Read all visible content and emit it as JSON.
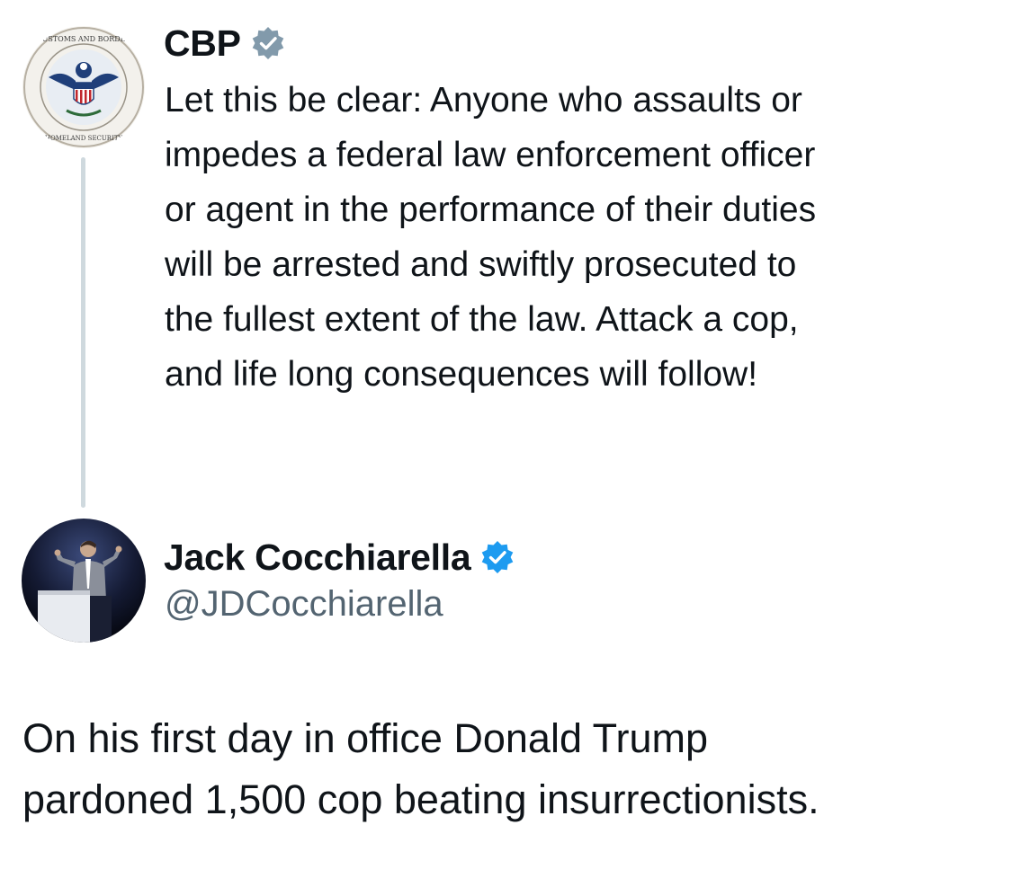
{
  "quoted_post": {
    "author_name": "CBP",
    "seal_text": {
      "outer_top": "U.S. CUSTOMS AND BORDER PROTECTION",
      "outer_bottom": "DEPARTMENT OF HOMELAND SECURITY"
    },
    "verified_badge": "gray-check-badge-icon",
    "text": "Let this be clear: Anyone who assaults or\nimpedes a federal law enforcement officer\nor agent in the performance of their duties\nwill be arrested and swiftly prosecuted to\nthe fullest extent of the law. Attack a cop,\nand life long consequences will follow!"
  },
  "reply_post": {
    "author_name": "Jack Cocchiarella",
    "handle": "@JDCocchiarella",
    "verified_badge": "blue-check-badge-icon",
    "text": "On his first day in office Donald Trump\npardoned 1,500 cop beating insurrectionists."
  },
  "colors": {
    "text_primary": "#0f1419",
    "text_secondary": "#536471",
    "thread_line": "#cfd9de",
    "badge_gray": "#829aab",
    "badge_blue": "#1d9bf0"
  }
}
